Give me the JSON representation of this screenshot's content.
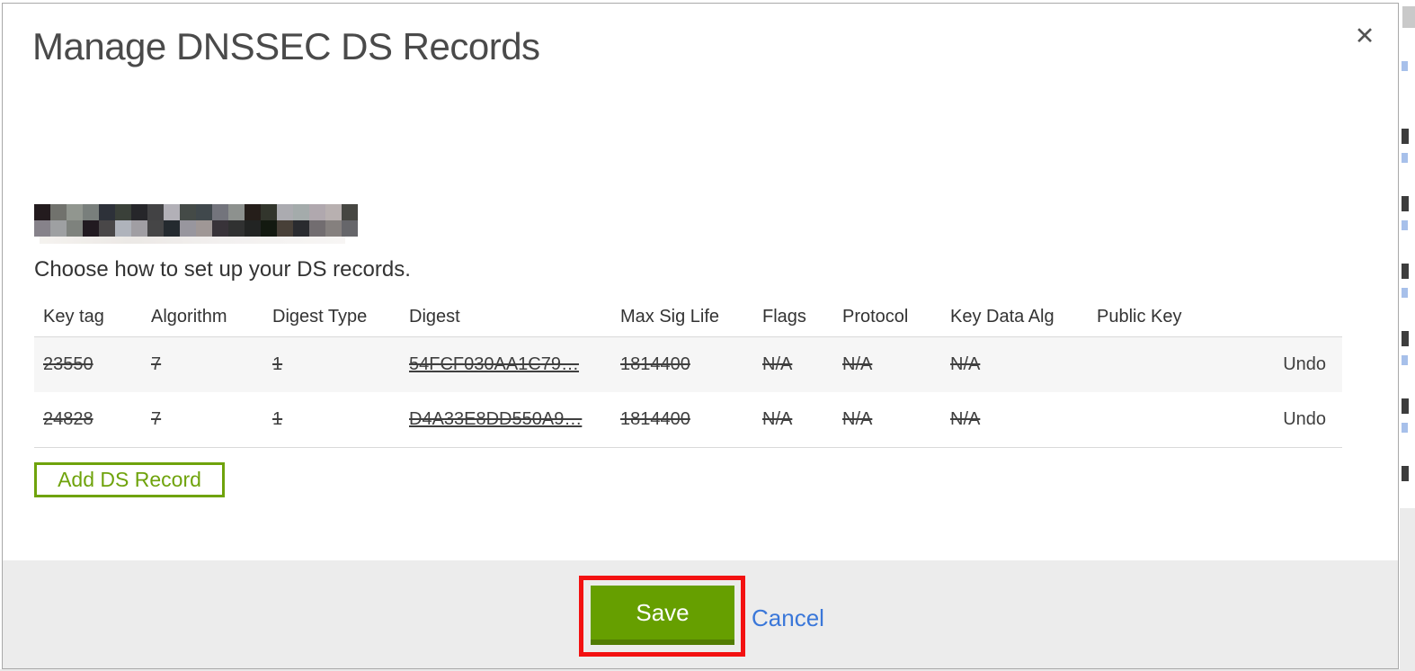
{
  "modal": {
    "title": "Manage DNSSEC DS Records",
    "close_label": "✕",
    "domain": {
      "redacted": true
    },
    "subtitle": "Choose how to set up your DS records.",
    "table": {
      "headers": [
        "Key tag",
        "Algorithm",
        "Digest Type",
        "Digest",
        "Max Sig Life",
        "Flags",
        "Protocol",
        "Key Data Alg",
        "Public Key"
      ],
      "rows": [
        {
          "key_tag": "23550",
          "algorithm": "7",
          "digest_type": "1",
          "digest": "54FCF030AA1C79…",
          "max_sig_life": "1814400",
          "flags": "N/A",
          "protocol": "N/A",
          "key_data_alg": "N/A",
          "public_key": "",
          "action": "Undo",
          "state": "marked-for-deletion"
        },
        {
          "key_tag": "24828",
          "algorithm": "7",
          "digest_type": "1",
          "digest": "D4A33E8DD550A9…",
          "max_sig_life": "1814400",
          "flags": "N/A",
          "protocol": "N/A",
          "key_data_alg": "N/A",
          "public_key": "",
          "action": "Undo",
          "state": "marked-for-deletion"
        }
      ]
    },
    "add_button_label": "Add DS Record",
    "footer": {
      "save_label": "Save",
      "cancel_label": "Cancel"
    },
    "annotation": {
      "shape": "red-rectangle",
      "target": "save-button",
      "color": "#f31111"
    }
  },
  "colors": {
    "accent_green": "#669f00",
    "accent_green_dark": "#517c04",
    "outline_green": "#6fa30c",
    "link_blue": "#3b7ae0",
    "annotation_red": "#f31111",
    "footer_gray": "#ececec",
    "row_shade": "#f6f6f6"
  }
}
